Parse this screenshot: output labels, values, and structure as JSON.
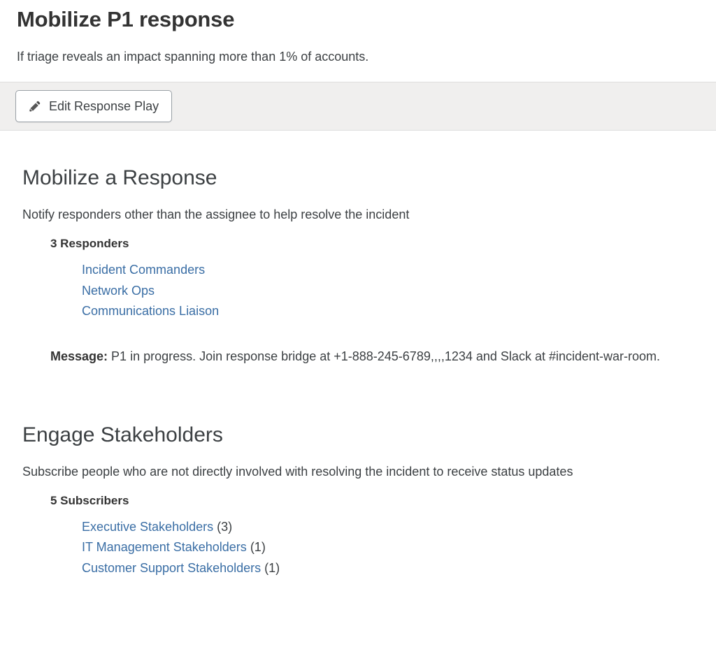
{
  "page": {
    "title": "Mobilize P1 response",
    "subtitle": "If triage reveals an impact spanning more than 1% of accounts."
  },
  "toolbar": {
    "edit_button_label": "Edit Response Play",
    "edit_button_icon": "pencil-icon"
  },
  "sections": [
    {
      "title": "Mobilize a Response",
      "description": "Notify responders other than the assignee to help resolve the incident",
      "detail_label": "3 Responders",
      "links": [
        {
          "label": "Incident Commanders",
          "count": ""
        },
        {
          "label": "Network Ops",
          "count": ""
        },
        {
          "label": "Communications Liaison",
          "count": ""
        }
      ],
      "message_label": "Message:",
      "message_body": " P1 in progress. Join response bridge at +1-888-245-6789,,,,1234 and Slack at #incident-war-room."
    },
    {
      "title": "Engage Stakeholders",
      "description": "Subscribe people who are not directly involved with resolving the incident to receive status updates",
      "detail_label": "5 Subscribers",
      "links": [
        {
          "label": "Executive Stakeholders",
          "count": " (3)"
        },
        {
          "label": "IT Management Stakeholders",
          "count": " (1)"
        },
        {
          "label": "Customer Support Stakeholders",
          "count": " (1)"
        }
      ]
    }
  ],
  "colors": {
    "link": "#3a6ea5",
    "heading": "#333333",
    "body": "#3c4043",
    "toolbar_bg": "#f0efee",
    "toolbar_border": "#dddddd"
  }
}
